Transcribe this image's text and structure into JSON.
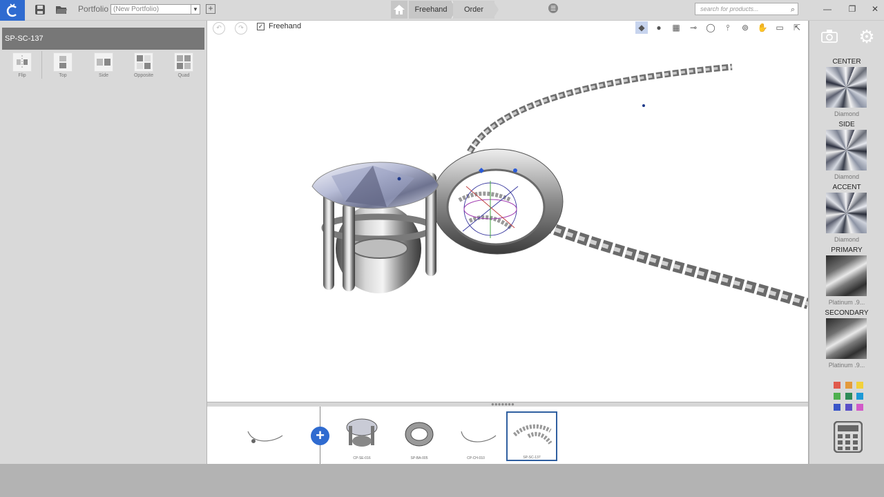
{
  "topbar": {
    "portfolio_label": "Portfolio",
    "portfolio_value": "(New Portfolio)",
    "crumbs": [
      "Freehand",
      "Order"
    ],
    "search_placeholder": "search for products..."
  },
  "left_panel": {
    "part_title": "SP-SC-137",
    "tools": [
      {
        "label": "Flip",
        "icon": "flip-icon"
      },
      {
        "label": "Top",
        "icon": "top-icon"
      },
      {
        "label": "Side",
        "icon": "side-icon"
      },
      {
        "label": "Opposite",
        "icon": "opposite-icon"
      },
      {
        "label": "Quad",
        "icon": "quad-icon"
      }
    ]
  },
  "viewport": {
    "freehand_label": "Freehand",
    "freehand_checked": true,
    "tools": [
      "gem-view-icon",
      "sphere-icon",
      "grid-icon",
      "measure-icon",
      "ring-icon",
      "bail-icon",
      "ring-size-icon",
      "hand-icon",
      "image-icon",
      "export-icon"
    ]
  },
  "tray": {
    "items": [
      {
        "label": "",
        "kind": "necklace"
      },
      {
        "label": "CP-SE-016",
        "kind": "setting"
      },
      {
        "label": "SP-BA-005",
        "kind": "bail"
      },
      {
        "label": "CP-CH-010",
        "kind": "chain"
      },
      {
        "label": "SP-SC-137",
        "kind": "scroll",
        "selected": true
      }
    ]
  },
  "right_panel": {
    "materials": [
      {
        "caption": "CENTER",
        "name": "Diamond",
        "type": "gem"
      },
      {
        "caption": "SIDE",
        "name": "Diamond",
        "type": "gem"
      },
      {
        "caption": "ACCENT",
        "name": "Diamond",
        "type": "gem"
      },
      {
        "caption": "PRIMARY",
        "name": "Platinum .9...",
        "type": "metal"
      },
      {
        "caption": "SECONDARY",
        "name": "Platinum .9...",
        "type": "metal"
      }
    ],
    "colors": [
      "#e05a4c",
      "#e39a3c",
      "#f2d13a",
      "#4fb04f",
      "#2e8b57",
      "#1e9ad6",
      "#3a56c8",
      "#5a4fc8",
      "#d25ac8"
    ]
  }
}
